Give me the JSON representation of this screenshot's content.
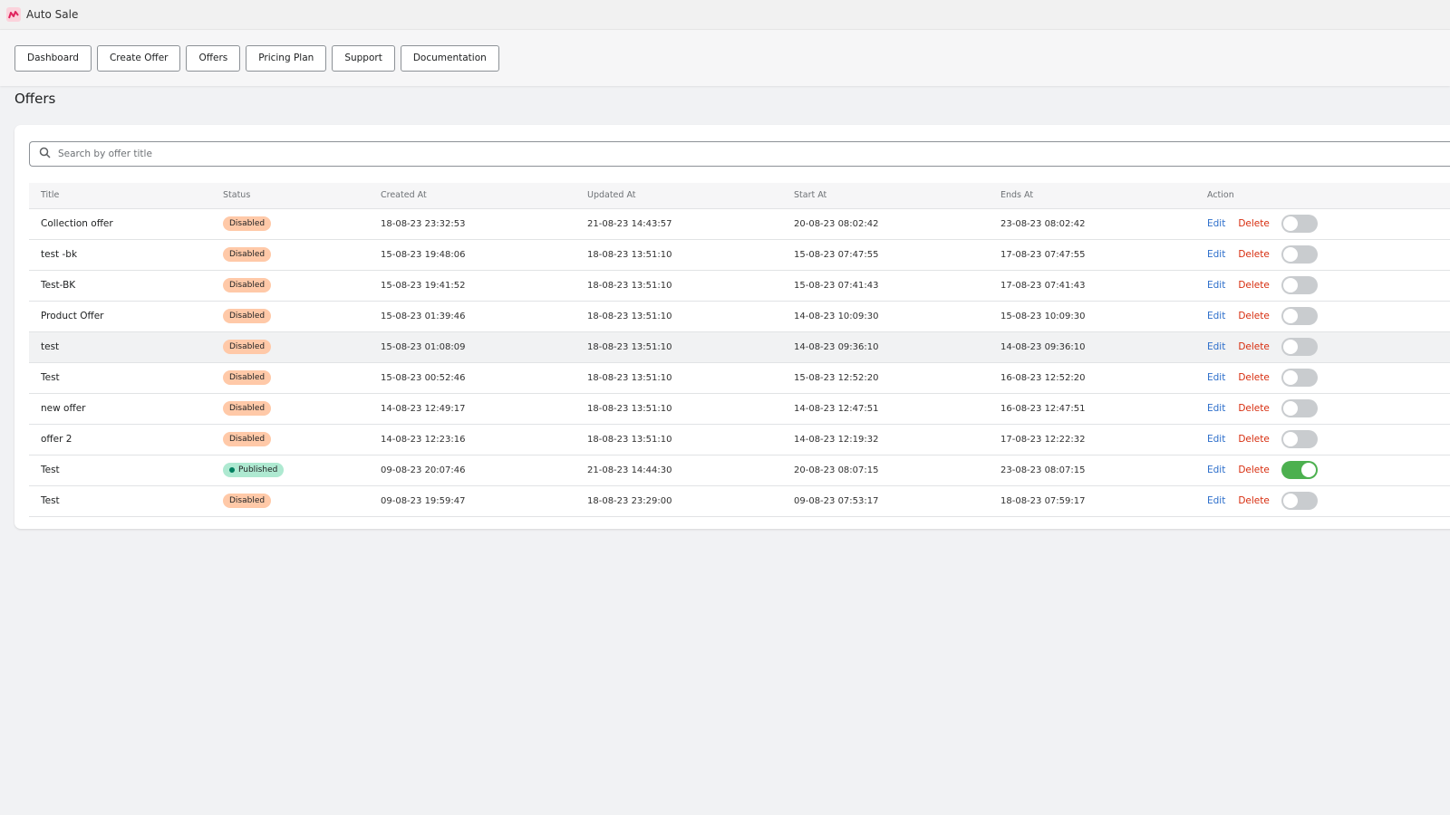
{
  "app": {
    "title": "Auto Sale",
    "logo_icon": "chart-logo-icon",
    "accent": "#e0245e"
  },
  "nav": [
    {
      "label": "Dashboard"
    },
    {
      "label": "Create Offer"
    },
    {
      "label": "Offers"
    },
    {
      "label": "Pricing Plan"
    },
    {
      "label": "Support"
    },
    {
      "label": "Documentation"
    }
  ],
  "page": {
    "title": "Offers"
  },
  "search": {
    "placeholder": "Search by offer title",
    "value": "",
    "icon": "search-icon"
  },
  "table": {
    "columns": [
      "Title",
      "Status",
      "Created At",
      "Updated At",
      "Start At",
      "Ends At",
      "Action"
    ],
    "action_labels": {
      "edit": "Edit",
      "delete": "Delete"
    },
    "rows": [
      {
        "title": "Collection offer",
        "status": "Disabled",
        "created": "18-08-23 23:32:53",
        "updated": "21-08-23 14:43:57",
        "start": "20-08-23 08:02:42",
        "ends": "23-08-23 08:02:42",
        "enabled": false
      },
      {
        "title": "test -bk",
        "status": "Disabled",
        "created": "15-08-23 19:48:06",
        "updated": "18-08-23 13:51:10",
        "start": "15-08-23 07:47:55",
        "ends": "17-08-23 07:47:55",
        "enabled": false
      },
      {
        "title": "Test-BK",
        "status": "Disabled",
        "created": "15-08-23 19:41:52",
        "updated": "18-08-23 13:51:10",
        "start": "15-08-23 07:41:43",
        "ends": "17-08-23 07:41:43",
        "enabled": false
      },
      {
        "title": "Product Offer",
        "status": "Disabled",
        "created": "15-08-23 01:39:46",
        "updated": "18-08-23 13:51:10",
        "start": "14-08-23 10:09:30",
        "ends": "15-08-23 10:09:30",
        "enabled": false
      },
      {
        "title": "test",
        "status": "Disabled",
        "created": "15-08-23 01:08:09",
        "updated": "18-08-23 13:51:10",
        "start": "14-08-23 09:36:10",
        "ends": "14-08-23 09:36:10",
        "enabled": false,
        "hovered": true
      },
      {
        "title": "Test",
        "status": "Disabled",
        "created": "15-08-23 00:52:46",
        "updated": "18-08-23 13:51:10",
        "start": "15-08-23 12:52:20",
        "ends": "16-08-23 12:52:20",
        "enabled": false
      },
      {
        "title": "new offer",
        "status": "Disabled",
        "created": "14-08-23 12:49:17",
        "updated": "18-08-23 13:51:10",
        "start": "14-08-23 12:47:51",
        "ends": "16-08-23 12:47:51",
        "enabled": false
      },
      {
        "title": "offer 2",
        "status": "Disabled",
        "created": "14-08-23 12:23:16",
        "updated": "18-08-23 13:51:10",
        "start": "14-08-23 12:19:32",
        "ends": "17-08-23 12:22:32",
        "enabled": false
      },
      {
        "title": "Test",
        "status": "Published",
        "created": "09-08-23 20:07:46",
        "updated": "21-08-23 14:44:30",
        "start": "20-08-23 08:07:15",
        "ends": "23-08-23 08:07:15",
        "enabled": true
      },
      {
        "title": "Test",
        "status": "Disabled",
        "created": "09-08-23 19:59:47",
        "updated": "18-08-23 23:29:00",
        "start": "09-08-23 07:53:17",
        "ends": "18-08-23 07:59:17",
        "enabled": false
      }
    ]
  },
  "colors": {
    "disabled_badge": "#ffc9a8",
    "published_badge": "#aee9d1",
    "edit_link": "#2c6ecb",
    "delete_link": "#d72c0d",
    "toggle_on": "#4cb04f",
    "toggle_off": "#c9cccf"
  }
}
